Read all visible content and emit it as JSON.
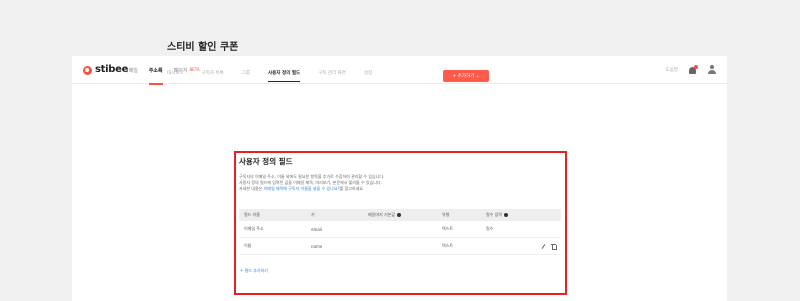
{
  "brand": {
    "logo_text": "stibee",
    "accent": "#ff4f3f"
  },
  "nav": {
    "items": [
      {
        "label": "이메일",
        "active": false
      },
      {
        "label": "주소록",
        "active": true
      },
      {
        "label": "페이지",
        "badge": "BETA",
        "active": false
      }
    ]
  },
  "header_right": {
    "guide": "도움말"
  },
  "page": {
    "title": "스티비 할인 쿠폰"
  },
  "tabs": [
    "대시보드",
    "구독자 목록",
    "그룹",
    "사용자 정의 필드",
    "구독 관리 화면",
    "설정"
  ],
  "add_button": {
    "label": "+ 추가하기 ⌄"
  },
  "section": {
    "title": "사용자 정의 필드",
    "desc": [
      "구독자의 이메일 주소, 이름 외에도 필요한 항목을 추가로 수집하여 관리할 수 있습니다.",
      "사용자 정의 필드에 입력된 값을 이메일 제목, 미리보기, 본문에서 불러올 수 있습니다."
    ],
    "desc3_pre": "자세한 내용은 ",
    "desc3_link": "이메일 제목에 구독자 이름을 넣을 수 있나요?",
    "desc3_post": "를 참고하세요."
  },
  "table": {
    "headers": [
      "필드 이름",
      "키",
      "메일머지 기본값",
      "유형",
      "필수 입력"
    ],
    "rows": [
      {
        "name": "이메일 주소",
        "key": "email",
        "default": "",
        "type": "텍스트",
        "required": "필수"
      },
      {
        "name": "이름",
        "key": "name",
        "default": "",
        "type": "텍스트",
        "required": ""
      }
    ]
  },
  "add_field": "+ 필드 추가하기"
}
